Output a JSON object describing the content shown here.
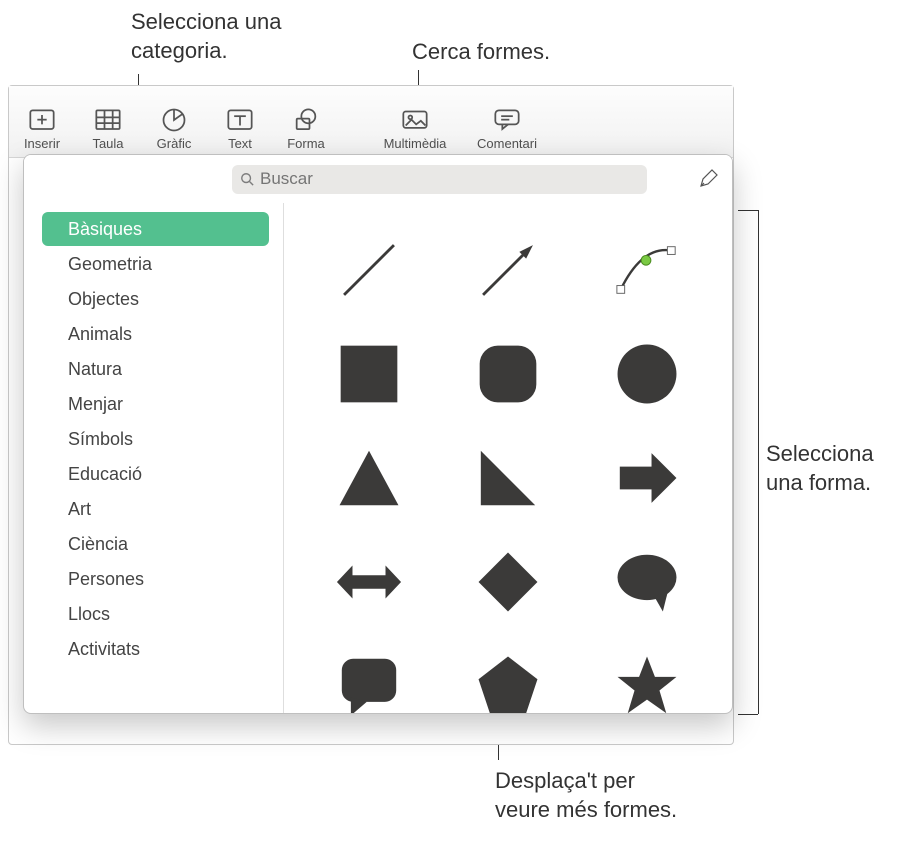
{
  "callouts": {
    "select_category": "Selecciona una\ncategoria.",
    "search_shapes": "Cerca formes.",
    "select_shape": "Selecciona\nuna forma.",
    "scroll_more": "Desplaça't per\nveure més formes."
  },
  "toolbar": {
    "insert": "Inserir",
    "table": "Taula",
    "chart": "Gràfic",
    "text": "Text",
    "shape": "Forma",
    "media": "Multimèdia",
    "comment": "Comentari"
  },
  "search": {
    "placeholder": "Buscar"
  },
  "categories": [
    {
      "label": "Bàsiques",
      "selected": true
    },
    {
      "label": "Geometria",
      "selected": false
    },
    {
      "label": "Objectes",
      "selected": false
    },
    {
      "label": "Animals",
      "selected": false
    },
    {
      "label": "Natura",
      "selected": false
    },
    {
      "label": "Menjar",
      "selected": false
    },
    {
      "label": "Símbols",
      "selected": false
    },
    {
      "label": "Educació",
      "selected": false
    },
    {
      "label": "Art",
      "selected": false
    },
    {
      "label": "Ciència",
      "selected": false
    },
    {
      "label": "Persones",
      "selected": false
    },
    {
      "label": "Llocs",
      "selected": false
    },
    {
      "label": "Activitats",
      "selected": false
    }
  ],
  "shapes": [
    {
      "name": "line"
    },
    {
      "name": "arrow-line"
    },
    {
      "name": "curve-editable"
    },
    {
      "name": "square"
    },
    {
      "name": "rounded-square"
    },
    {
      "name": "circle"
    },
    {
      "name": "triangle"
    },
    {
      "name": "right-triangle"
    },
    {
      "name": "arrow-right"
    },
    {
      "name": "arrow-left-right"
    },
    {
      "name": "diamond"
    },
    {
      "name": "speech-bubble-oval"
    },
    {
      "name": "speech-bubble-rect"
    },
    {
      "name": "pentagon"
    },
    {
      "name": "star"
    }
  ]
}
